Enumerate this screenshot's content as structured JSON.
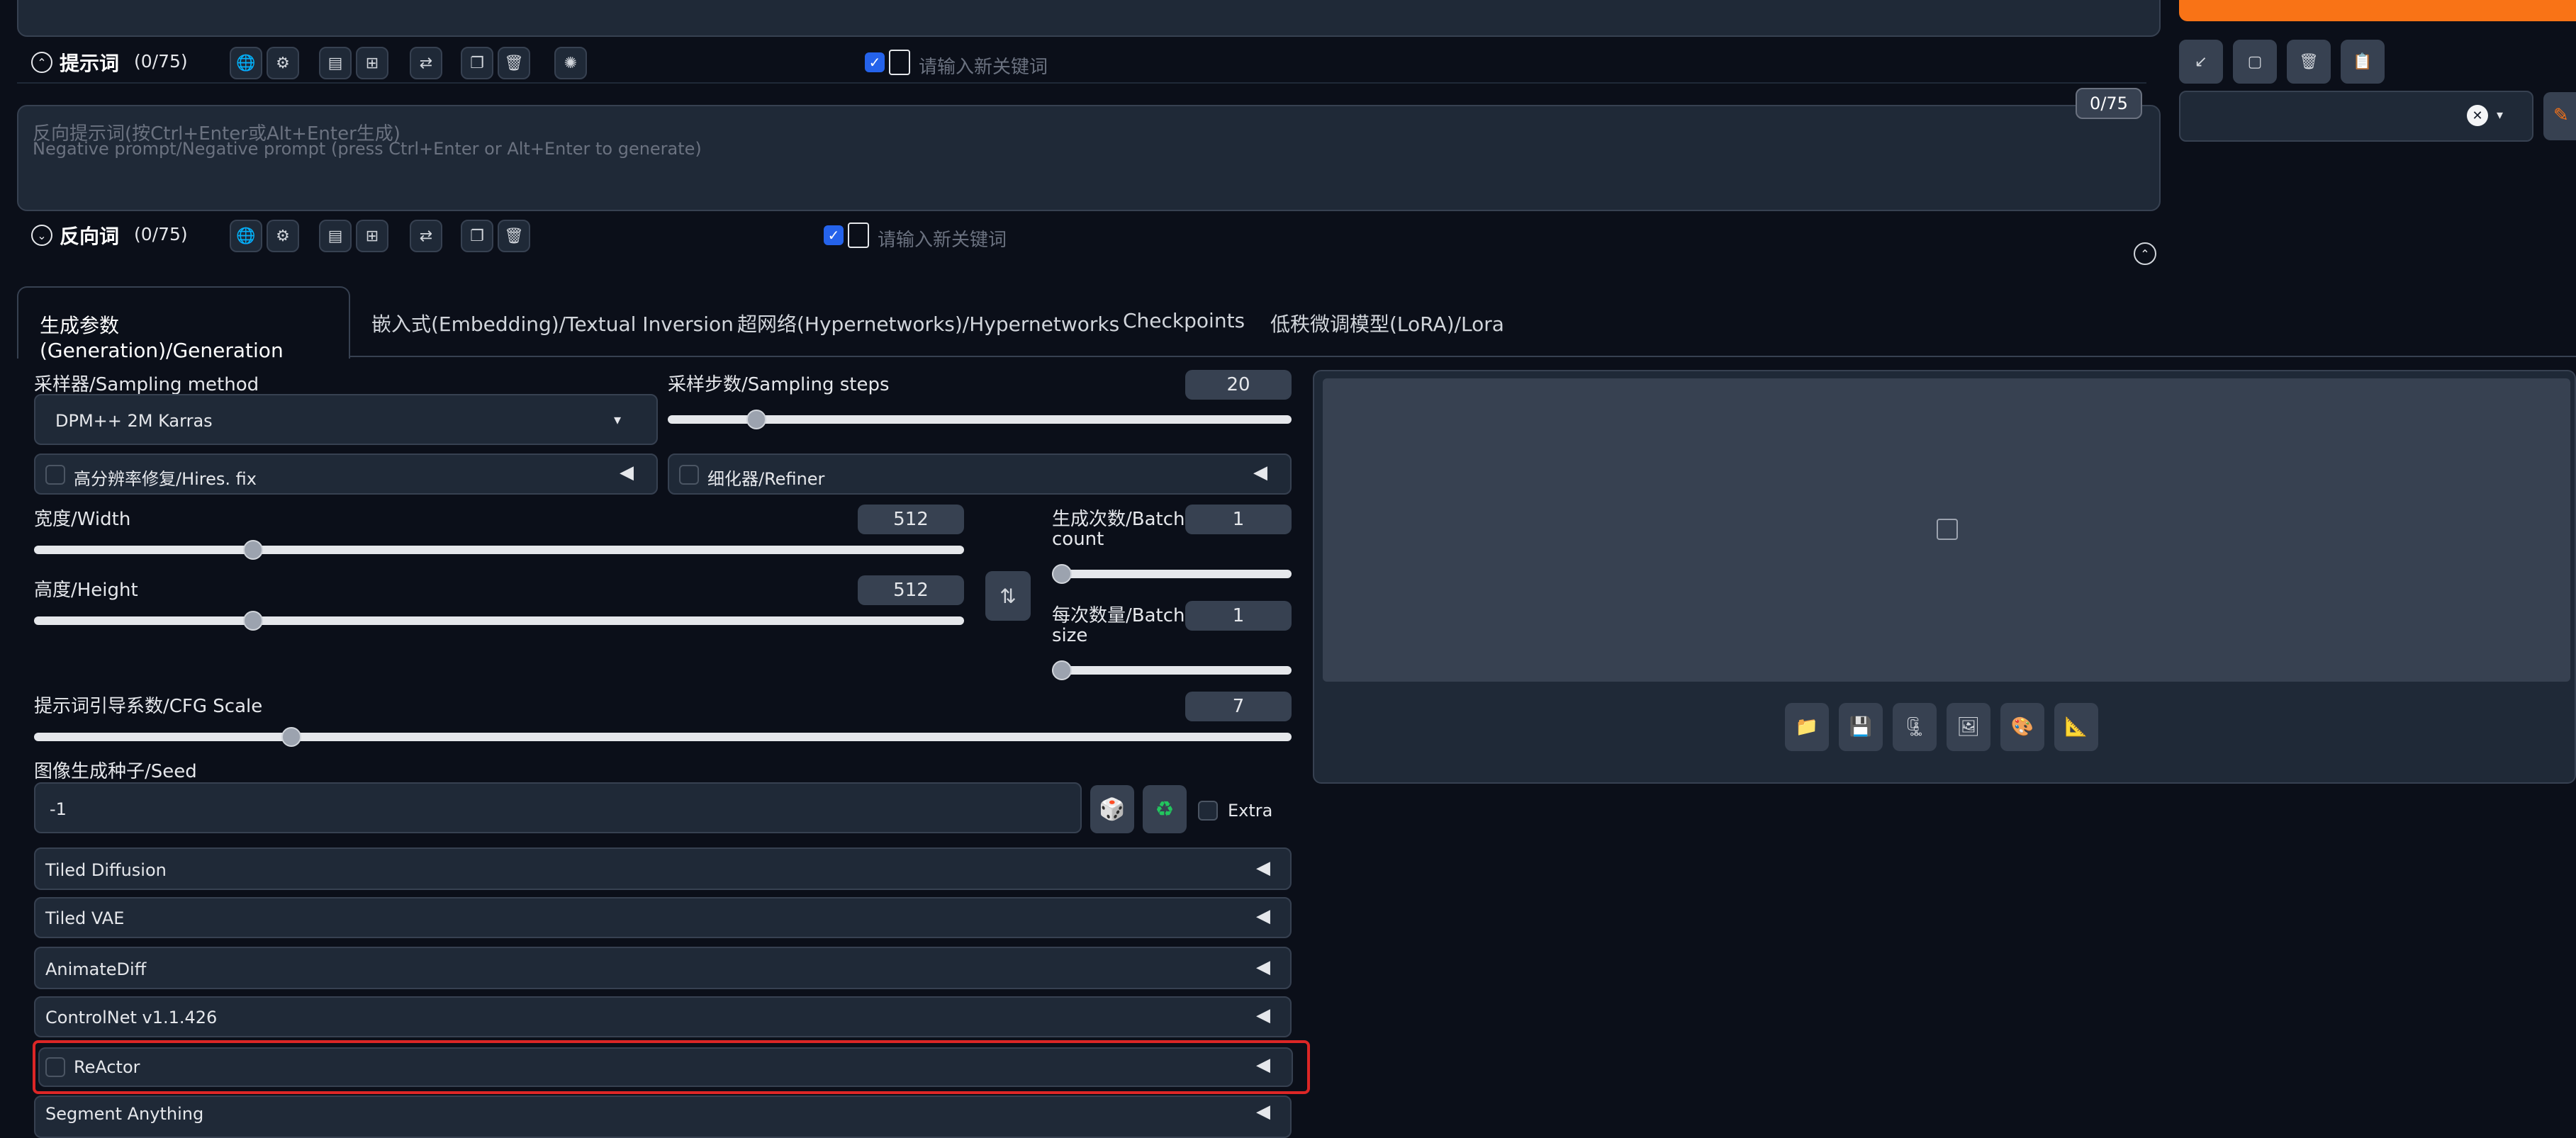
{
  "prompt": {
    "label": "提示词",
    "count": "(0/75)",
    "keyword_placeholder": "请输入新关键词"
  },
  "negative": {
    "placeholder_line1": "反向提示词(按Ctrl+Enter或Alt+Enter生成)",
    "placeholder_line2": "Negative prompt/Negative prompt (press Ctrl+Enter or Alt+Enter to generate)",
    "token_counter": "0/75",
    "label": "反向词",
    "count": "(0/75)",
    "keyword_placeholder": "请输入新关键词"
  },
  "tabs": [
    "生成参数(Generation)/Generation",
    "嵌入式(Embedding)/Textual Inversion",
    "超网络(Hypernetworks)/Hypernetworks",
    "Checkpoints",
    "低秩微调模型(LoRA)/Lora"
  ],
  "sampler": {
    "label": "采样器/Sampling method",
    "value": "DPM++ 2M Karras"
  },
  "steps": {
    "label": "采样步数/Sampling steps",
    "value": "20",
    "fraction": 0.13
  },
  "hires": {
    "label": "高分辨率修复/Hires. fix"
  },
  "refiner": {
    "label": "细化器/Refiner"
  },
  "width": {
    "label": "宽度/Width",
    "value": "512",
    "fraction": 0.23
  },
  "height": {
    "label": "高度/Height",
    "value": "512",
    "fraction": 0.23
  },
  "batch_count": {
    "label_line1": "生成次数/Batch",
    "label_line2": "count",
    "value": "1",
    "fraction": 0
  },
  "batch_size": {
    "label_line1": "每次数量/Batch",
    "label_line2": "size",
    "value": "1",
    "fraction": 0
  },
  "cfg": {
    "label": "提示词引导系数/CFG Scale",
    "value": "7",
    "fraction": 0.2
  },
  "seed": {
    "label": "图像生成种子/Seed",
    "value": "-1",
    "extra_label": "Extra"
  },
  "accordions": [
    "Tiled Diffusion",
    "Tiled VAE",
    "AnimateDiff",
    "ControlNet v1.1.426",
    "ReActor",
    "Segment Anything"
  ],
  "colors": {
    "accent_orange": "#f97316",
    "highlight_red": "#dc2626"
  },
  "icons": {
    "top_right": [
      "arrow-down-left-icon",
      "square-icon",
      "trash-icon",
      "clipboard-icon"
    ],
    "output": [
      "folder-icon",
      "save-icon",
      "zip-icon",
      "image-icon",
      "palette-icon",
      "ruler-icon"
    ]
  }
}
